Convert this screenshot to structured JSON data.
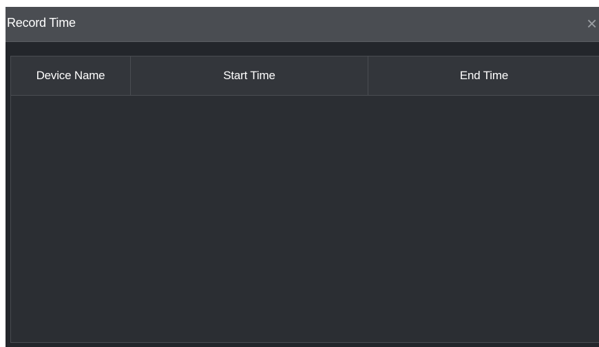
{
  "dialog": {
    "title": "Record Time",
    "close_glyph": "×",
    "close_icon": "close-icon"
  },
  "table": {
    "columns": [
      "Device Name",
      "Start Time",
      "End Time"
    ],
    "rows": []
  }
}
